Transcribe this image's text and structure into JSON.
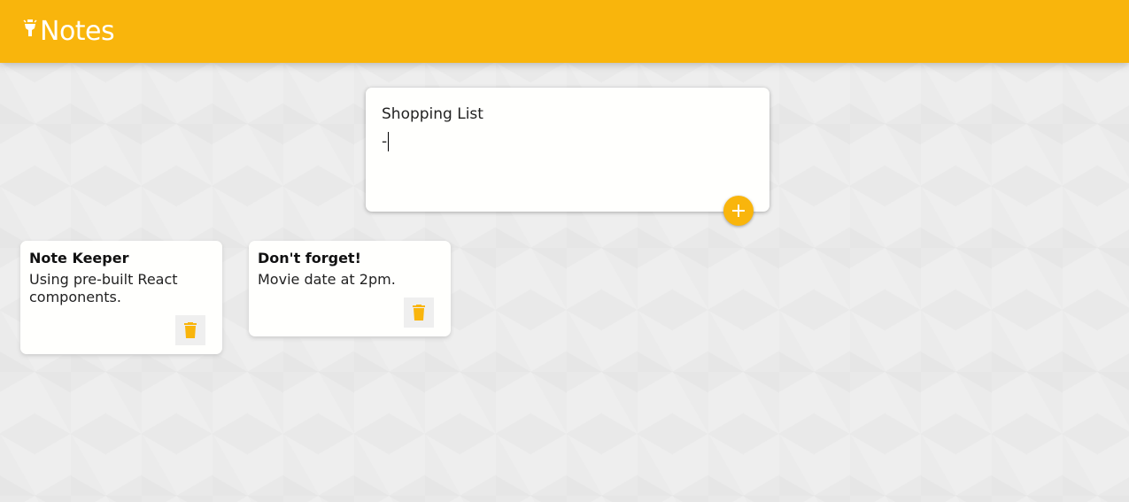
{
  "colors": {
    "accent": "#f9b50c",
    "header_bg": "#f9b50c",
    "page_bg": "#eeeeee",
    "card_bg": "#fffffd"
  },
  "header": {
    "title": "Notes",
    "icon": "lightbulb-icon"
  },
  "create_form": {
    "title_value": "Shopping List",
    "content_value": "-",
    "add_icon": "plus-icon"
  },
  "notes": [
    {
      "title": "Note Keeper",
      "content": "Using pre-built React components.",
      "delete_icon": "trash-icon"
    },
    {
      "title": "Don't forget!",
      "content": "Movie date at 2pm.",
      "delete_icon": "trash-icon"
    }
  ]
}
